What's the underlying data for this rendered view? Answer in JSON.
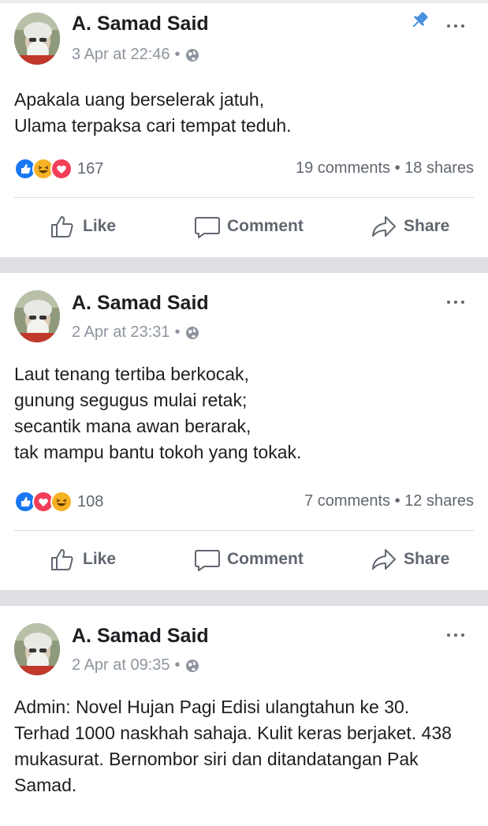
{
  "colors": {
    "like_blue": "#1877f2",
    "love_red": "#f33e58",
    "haha_yellow": "#f7b125",
    "pin_blue": "#4a90e2",
    "meta_gray": "#8d949e"
  },
  "posts": [
    {
      "author": "A. Samad Said",
      "time": "3 Apr at 22:46",
      "meta_dot": "•",
      "pinned": true,
      "lines": [
        "Apakala uang berselerak jatuh,",
        "Ulama terpaksa cari tempat teduh."
      ],
      "reactions": [
        "like",
        "haha",
        "love"
      ],
      "reaction_count": "167",
      "stats": "19 comments • 18 shares",
      "actions": {
        "like": "Like",
        "comment": "Comment",
        "share": "Share"
      }
    },
    {
      "author": "A. Samad Said",
      "time": "2 Apr at 23:31",
      "meta_dot": "•",
      "pinned": false,
      "lines": [
        "Laut tenang tertiba berkocak,",
        "gunung segugus mulai retak;",
        "secantik mana awan berarak,",
        "tak mampu bantu tokoh yang tokak."
      ],
      "reactions": [
        "like",
        "love",
        "haha"
      ],
      "reaction_count": "108",
      "stats": "7 comments • 12 shares",
      "actions": {
        "like": "Like",
        "comment": "Comment",
        "share": "Share"
      }
    },
    {
      "author": "A. Samad Said",
      "time": "2 Apr at 09:35",
      "meta_dot": "•",
      "pinned": false,
      "lines": [
        "Admin: Novel Hujan Pagi Edisi ulangtahun ke 30.",
        "Terhad 1000 naskhah sahaja. Kulit keras berjaket. 438",
        "mukasurat. Bernombor siri dan ditandatangan Pak",
        "Samad."
      ]
    }
  ],
  "icons": {
    "globe": "globe-icon",
    "more": "more-options-icon",
    "pin": "pin-icon",
    "like": "thumbs-up-icon",
    "comment": "speech-bubble-icon",
    "share": "share-arrow-icon"
  }
}
